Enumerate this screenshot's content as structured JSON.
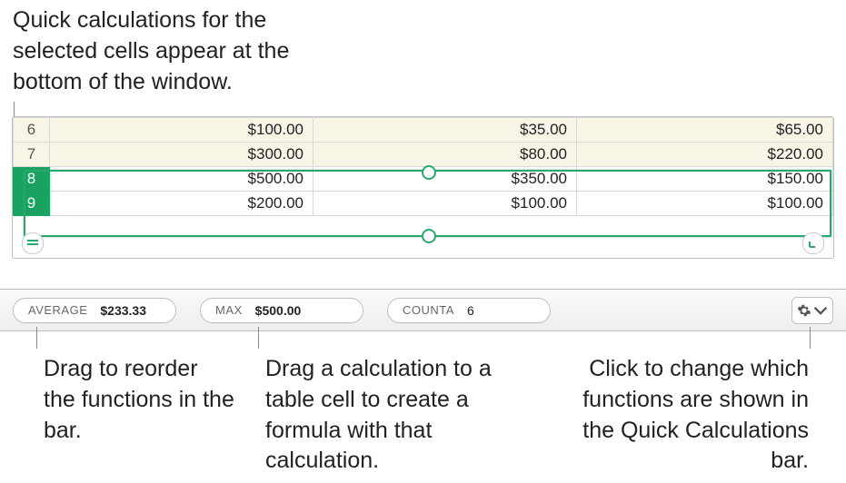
{
  "callouts": {
    "top": "Quick calculations for the selected cells appear at the bottom of the window.",
    "left": "Drag to reorder the functions in the bar.",
    "middle": "Drag a calculation to a table cell to create a formula with that calculation.",
    "right": "Click to change which functions are shown in the Quick Calculations bar."
  },
  "rows": [
    {
      "n": "6",
      "selected": false,
      "hl": true,
      "c1": "$100.00",
      "c2": "$35.00",
      "c3": "$65.00"
    },
    {
      "n": "7",
      "selected": false,
      "hl": true,
      "c1": "$300.00",
      "c2": "$80.00",
      "c3": "$220.00"
    },
    {
      "n": "8",
      "selected": true,
      "hl": false,
      "c1": "$500.00",
      "c2": "$350.00",
      "c3": "$150.00"
    },
    {
      "n": "9",
      "selected": true,
      "hl": false,
      "c1": "$200.00",
      "c2": "$100.00",
      "c3": "$100.00"
    }
  ],
  "calc": {
    "average": {
      "label": "AVERAGE",
      "value": "$233.33"
    },
    "max": {
      "label": "MAX",
      "value": "$500.00"
    },
    "counta": {
      "label": "COUNTA",
      "value": "6"
    }
  }
}
